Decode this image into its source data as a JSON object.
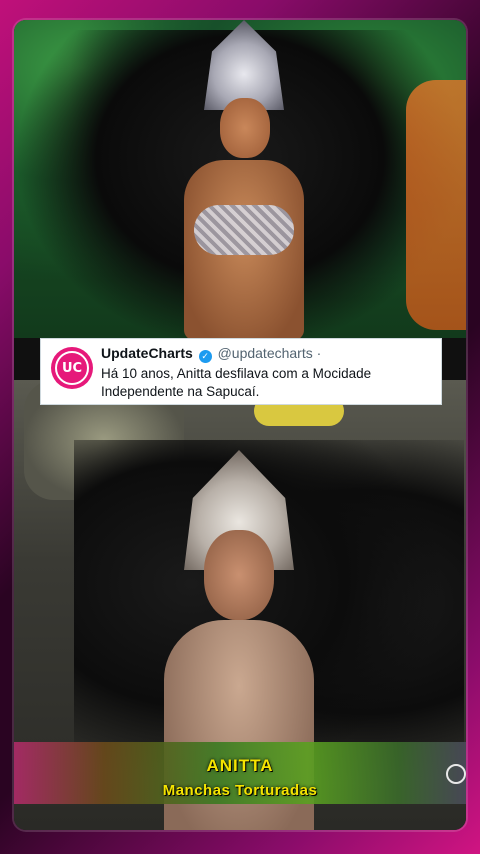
{
  "tweet": {
    "display_name": "UpdateCharts",
    "handle": "@updatecharts",
    "separator": "·",
    "text": "Há 10 anos, Anitta desfilava com a Mocidade Independente na Sapucaí.",
    "avatar_text": "UC",
    "verified_icon": "verified-badge-icon"
  },
  "broadcast_caption": {
    "name": "ANITTA",
    "subtitle": "Manchas Torturadas"
  },
  "colors": {
    "frame_gradient_primary": "#c0107a",
    "avatar_bg": "#e6197a",
    "caption_text": "#f5e400",
    "verified": "#1d9bf0"
  }
}
